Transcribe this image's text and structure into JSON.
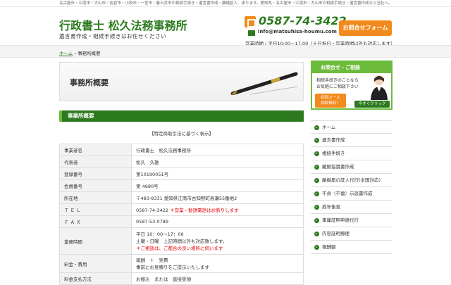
{
  "topbar": {
    "text": "名古屋市・江南市・犬山市・岩倉市・小牧市・一宮市・春日井市の相続手続き・遺言書作成・離婚証人、承ります。愛知県・名古屋市・江南市・犬山市の相続手続き・遺言書作成なら当社へ。"
  },
  "header": {
    "title": "行政書士 松久法務事務所",
    "subtitle": "遺言書作成・相続手続きはお任せください",
    "phone": "0587-74-3422",
    "email": "info@matsuhisa-houmu.com",
    "hours": "営業時間 / 平日10:00～17:00（土日祝日・営業時間以外も対応します）",
    "contact_button": "お問合せフォーム",
    "phone_icon": "phone-icon",
    "mail_icon": "mail-icon"
  },
  "breadcrumb": {
    "home": "ホーム",
    "separator": "›",
    "current": "事務所概要"
  },
  "hero": {
    "title": "事務所概要"
  },
  "section": {
    "heading": "事業所概要",
    "subheading": "【特定商取引法に基づく表示】"
  },
  "table": [
    {
      "label": "事業者名",
      "value": "行政書士　松久法務事務所"
    },
    {
      "label": "代表者",
      "value": "松久　久雄"
    },
    {
      "label": "登録番号",
      "value": "第10190051号"
    },
    {
      "label": "会員番号",
      "value": "第 4680号"
    },
    {
      "label": "所在地",
      "value": "〒483-8331 愛知県江南市古知野町高瀬55番地2"
    },
    {
      "label": "Ｔ Ｅ Ｌ",
      "value": "0587-74-3422",
      "note": "＊営業・勧誘電話はお断りします"
    },
    {
      "label": "Ｆ Ａ Ｘ",
      "value": "0587-53-0789"
    },
    {
      "label": "業務時間",
      "lines": [
        "平日 10：00～17：00",
        "土曜・日曜　上記時間以外も対応致します。"
      ],
      "note": "＊ご相談は、ご都合の良い場所に伺います"
    },
    {
      "label": "料金・費用",
      "lines": [
        "報酬　＋　実費",
        "事前にお見積りをご提示いたします"
      ]
    },
    {
      "label": "料金支払方法",
      "value": "お振込　または　直接受領"
    }
  ],
  "promo": {
    "heading": "お問合せ・ご相談",
    "line1": "相続手続きのことなら",
    "line2": "お気軽にご相談下さい",
    "badge1": "初回メール",
    "badge2": "相談無料！",
    "click": "今すぐクリック"
  },
  "sidebar": {
    "items": [
      "ホーム",
      "遺言書作成",
      "相続手続き",
      "離婚協議書作成",
      "離婚届の証人代行(全国対応)",
      "不貞（不倫）示談書作成",
      "成年後見",
      "車庫証明申請代行",
      "内容証明郵便",
      "報酬額"
    ]
  },
  "colors": {
    "accent": "#2d7a1e",
    "accent_light": "#6cbb3c",
    "orange": "#f28b1d",
    "red": "#e60000"
  }
}
